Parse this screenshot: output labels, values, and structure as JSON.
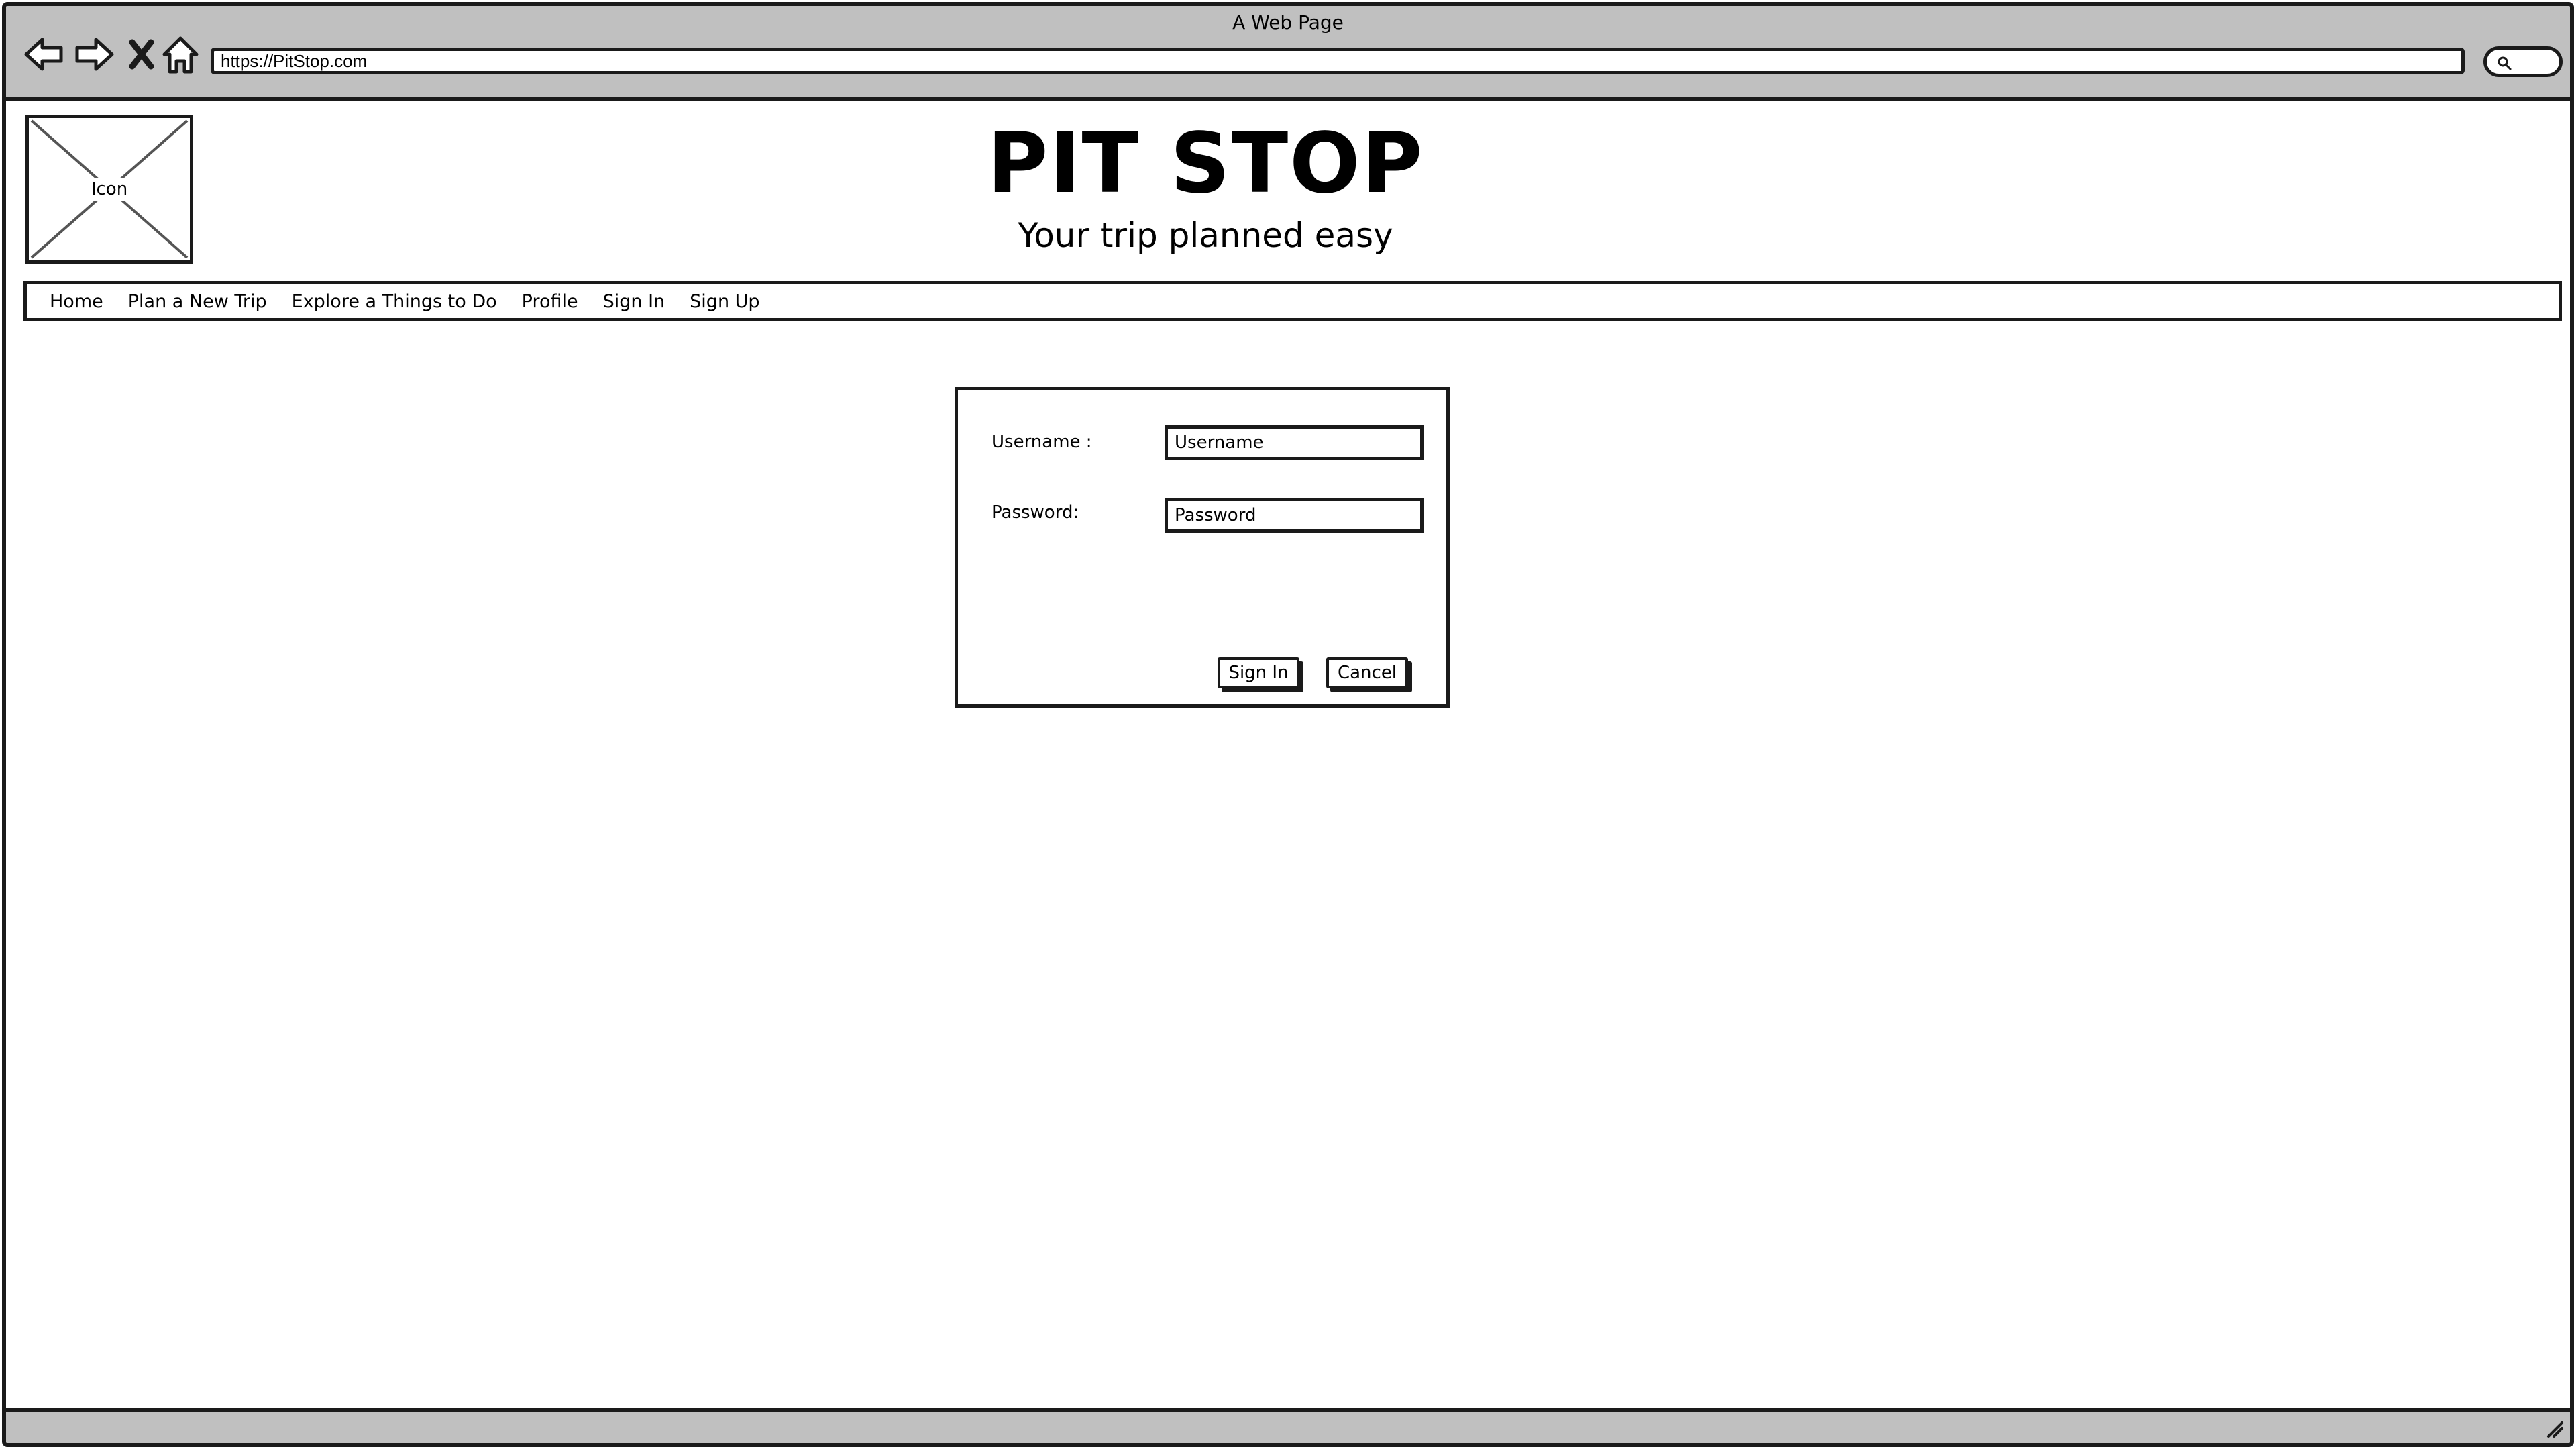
{
  "browser": {
    "window_title": "A Web Page",
    "url": "https://PitStop.com",
    "icons": [
      "back-arrow-icon",
      "forward-arrow-icon",
      "close-icon",
      "home-icon",
      "search-icon",
      "resize-grip-icon"
    ]
  },
  "header": {
    "logo_label": "Icon",
    "title": "PIT STOP",
    "subtitle": "Your trip planned easy"
  },
  "nav": {
    "items": [
      {
        "label": "Home"
      },
      {
        "label": "Plan a New Trip"
      },
      {
        "label": "Explore a Things to Do"
      },
      {
        "label": "Profile"
      },
      {
        "label": "Sign In"
      },
      {
        "label": "Sign Up"
      }
    ]
  },
  "login": {
    "username_label": "Username :",
    "username_placeholder": "Username",
    "password_label": "Password:",
    "password_placeholder": "Password",
    "sign_in_label": "Sign In",
    "cancel_label": "Cancel"
  }
}
